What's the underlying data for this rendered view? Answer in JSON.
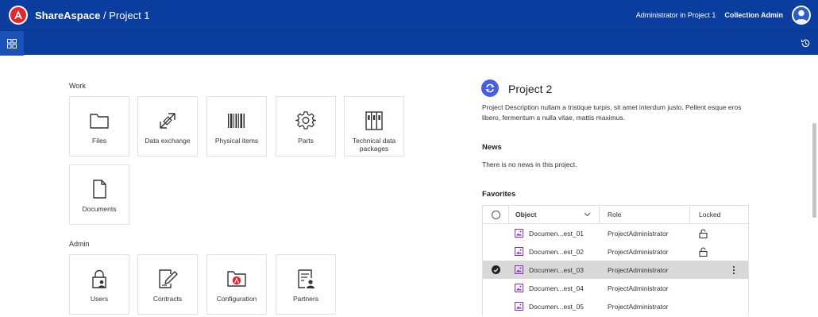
{
  "header": {
    "brand": "ShareAspace",
    "separator": " / ",
    "project": "Project 1",
    "role_text": "Administrator in Project 1",
    "collection_admin": "Collection Admin",
    "bar_color": "#0a3d9e"
  },
  "work": {
    "label": "Work",
    "tiles": [
      {
        "label": "Files",
        "icon": "folder-icon"
      },
      {
        "label": "Data exchange",
        "icon": "exchange-icon"
      },
      {
        "label": "Physical items",
        "icon": "barcode-icon"
      },
      {
        "label": "Parts",
        "icon": "gear-icon"
      },
      {
        "label": "Technical data packages",
        "icon": "binder-icon"
      },
      {
        "label": "Documents",
        "icon": "document-icon"
      }
    ]
  },
  "admin": {
    "label": "Admin",
    "tiles": [
      {
        "label": "Users",
        "icon": "user-lock-icon"
      },
      {
        "label": "Contracts",
        "icon": "contract-icon"
      },
      {
        "label": "Configuration",
        "icon": "config-folder-icon"
      },
      {
        "label": "Partners",
        "icon": "partners-icon"
      }
    ]
  },
  "project": {
    "title": "Project 2",
    "description": "Project Description nullam a tristique turpis, sit amet interdum justo. Pellent esque eros libero, fermentum a nulla vitae, mattis maximus.",
    "icon_color": "#4a5ee0"
  },
  "news": {
    "heading": "News",
    "text": "There is no news in this project."
  },
  "favorites": {
    "heading": "Favorites",
    "columns": {
      "object": "Object",
      "role": "Role",
      "locked": "Locked"
    },
    "rows": [
      {
        "object": "Documen...est_01",
        "role": "ProjectAdministrator",
        "locked": true,
        "selected": false
      },
      {
        "object": "Documen...est_02",
        "role": "ProjectAdministrator",
        "locked": true,
        "selected": false
      },
      {
        "object": "Documen...est_03",
        "role": "ProjectAdministrator",
        "locked": false,
        "selected": true
      },
      {
        "object": "Documen...est_04",
        "role": "ProjectAdministrator",
        "locked": false,
        "selected": false
      },
      {
        "object": "Documen...est_05",
        "role": "ProjectAdministrator",
        "locked": false,
        "selected": false
      }
    ]
  }
}
